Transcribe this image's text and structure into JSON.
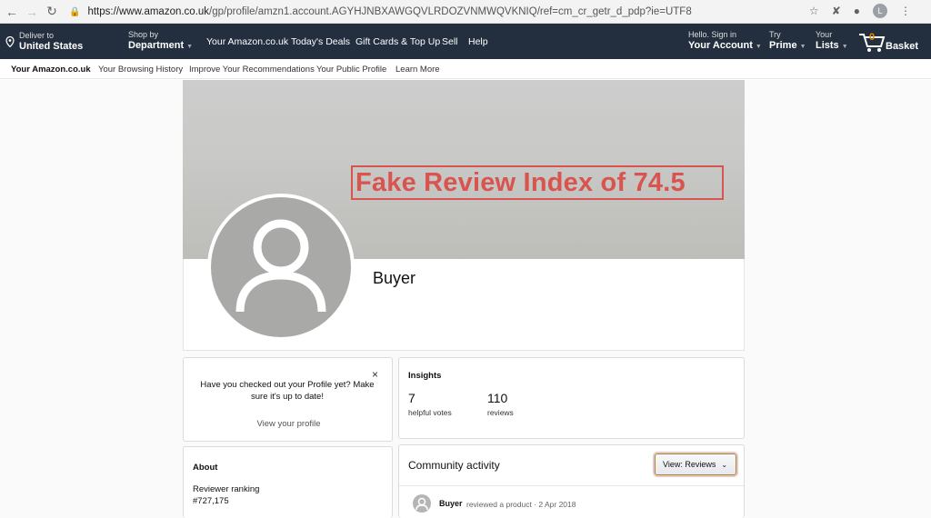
{
  "browser": {
    "url_host": "https://www.amazon.co.uk",
    "url_path": "/gp/profile/amzn1.account.AGYHJNBXAWGQVLRDOZVNMWQVKNIQ/ref=cm_cr_getr_d_pdp?ie=UTF8",
    "profile_initial": "L"
  },
  "nav": {
    "deliver_small": "Deliver to",
    "deliver_big": "United States",
    "shop_small": "Shop by",
    "shop_big": "Department",
    "links": [
      "Your Amazon.co.uk",
      "Today's Deals",
      "Gift Cards & Top Up",
      "Sell",
      "Help"
    ],
    "account_small": "Hello. Sign in",
    "account_big": "Your Account",
    "prime_small": "Try",
    "prime_big": "Prime",
    "lists_small": "Your",
    "lists_big": "Lists",
    "basket_count": "0",
    "basket_label": "Basket"
  },
  "subnav": {
    "items": [
      "Your Amazon.co.uk",
      "Your Browsing History",
      "Improve Your Recommendations",
      "Your Public Profile",
      "Learn More"
    ]
  },
  "profile": {
    "overlay_text": "Fake Review Index of 74.5",
    "name": "Buyer"
  },
  "promo": {
    "text": "Have you checked out your Profile yet? Make sure it's up to date!",
    "link": "View your profile",
    "close": "×"
  },
  "insights": {
    "title": "Insights",
    "helpful_votes": "7",
    "helpful_votes_label": "helpful votes",
    "reviews": "110",
    "reviews_label": "reviews"
  },
  "about": {
    "title": "About",
    "ranking_label": "Reviewer ranking",
    "ranking_value": "#727,175"
  },
  "community": {
    "title": "Community activity",
    "view_label": "View:",
    "view_value": "Reviews",
    "activity_name": "Buyer",
    "activity_text": "reviewed a product · 2 Apr 2018"
  },
  "colors": {
    "nav_bg": "#232f3e",
    "overlay_red": "#d9534f",
    "basket_orange": "#f08804"
  }
}
